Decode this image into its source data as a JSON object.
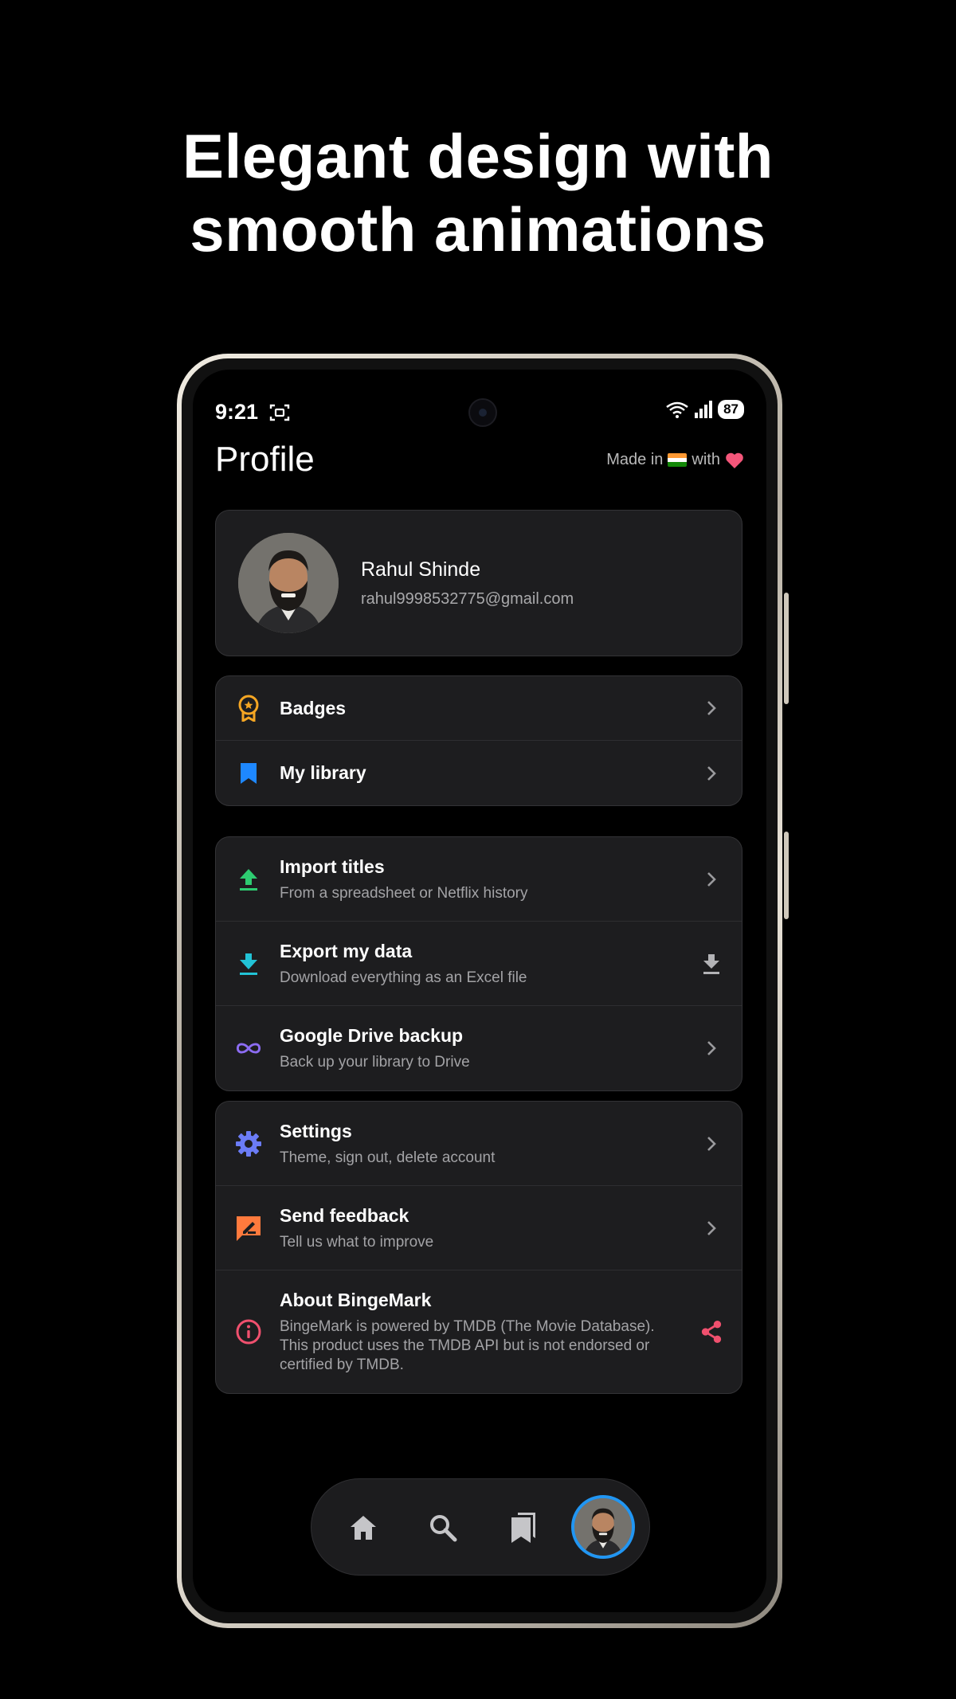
{
  "headline": {
    "line1": "Elegant design with",
    "line2": "smooth animations"
  },
  "status_bar": {
    "time": "9:21",
    "battery": "87"
  },
  "header": {
    "title": "Profile",
    "made_in_prefix": "Made in",
    "made_in_suffix": "with"
  },
  "profile": {
    "name": "Rahul Shinde",
    "email": "rahul9998532775@gmail.com"
  },
  "group1": [
    {
      "title": "Badges",
      "icon": "badge-icon",
      "color": "#f5a623"
    },
    {
      "title": "My library",
      "icon": "bookmark-icon",
      "color": "#1e88ff"
    }
  ],
  "group2": [
    {
      "title": "Import titles",
      "subtitle": "From a spreadsheet or Netflix history",
      "icon": "upload-icon",
      "color": "#2ecc71"
    },
    {
      "title": "Export my data",
      "subtitle": "Download everything as an Excel file",
      "icon": "download-icon",
      "color": "#22c3d6"
    },
    {
      "title": "Google Drive backup",
      "subtitle": "Back up your library to Drive",
      "icon": "infinity-icon",
      "color": "#8c6cf2"
    }
  ],
  "group3": [
    {
      "title": "Settings",
      "subtitle": "Theme, sign out, delete account",
      "icon": "gear-icon",
      "color": "#6b7cf6"
    },
    {
      "title": "Send feedback",
      "subtitle": "Tell us what to improve",
      "icon": "feedback-icon",
      "color": "#ff7a3d"
    },
    {
      "title": "About BingeMark",
      "subtitle": "BingeMark is powered by TMDB (The Movie Database). This product uses the TMDB API but is not endorsed or certified by TMDB.",
      "icon": "info-icon",
      "color": "#f0506e"
    }
  ],
  "bottom_nav": [
    "home-icon",
    "search-icon",
    "library-icon",
    "profile-avatar"
  ]
}
